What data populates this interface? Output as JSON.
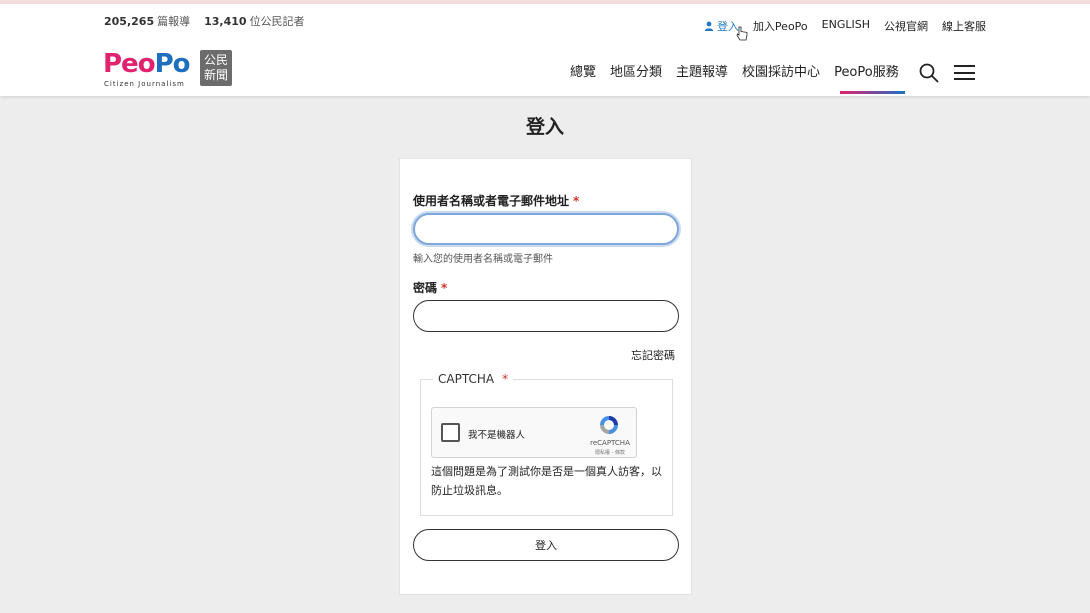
{
  "header": {
    "stats": [
      {
        "num": "205,265",
        "unit": "篇報導"
      },
      {
        "num": "13,410",
        "unit": "位公民記者"
      }
    ],
    "top_links": {
      "login": "登入",
      "join": "加入PeoPo",
      "english": "ENGLISH",
      "pts": "公視官網",
      "support": "線上客服"
    },
    "logo": {
      "peo": "Peo",
      "po": "Po",
      "badge_line1": "公民",
      "badge_line2": "新聞",
      "subtitle": "Citizen Journalism"
    },
    "nav": [
      "總覽",
      "地區分類",
      "主題報導",
      "校園採訪中心",
      "PeoPo服務"
    ],
    "search_icon": "search-icon",
    "menu_icon": "hamburger-menu-icon"
  },
  "page": {
    "title": "登入"
  },
  "form": {
    "username_label": "使用者名稱或者電子郵件地址",
    "required_mark": "*",
    "username_value": "",
    "username_hint": "輸入您的使用者名稱或電子郵件",
    "password_label": "密碼",
    "password_value": "",
    "forgot_password": "忘記密碼",
    "captcha_legend": "CAPTCHA",
    "recaptcha_checkbox_label": "我不是機器人",
    "recaptcha_brand": "reCAPTCHA",
    "recaptcha_terms": "隱私權 - 條款",
    "captcha_description": "這個問題是為了測試你是否是一個真人訪客，以防止垃圾訊息。",
    "submit_label": "登入"
  },
  "colors": {
    "brand_pink": "#e0226f",
    "brand_blue": "#1f6fc0",
    "link_blue": "#2479c4",
    "required_red": "#d0312d"
  }
}
